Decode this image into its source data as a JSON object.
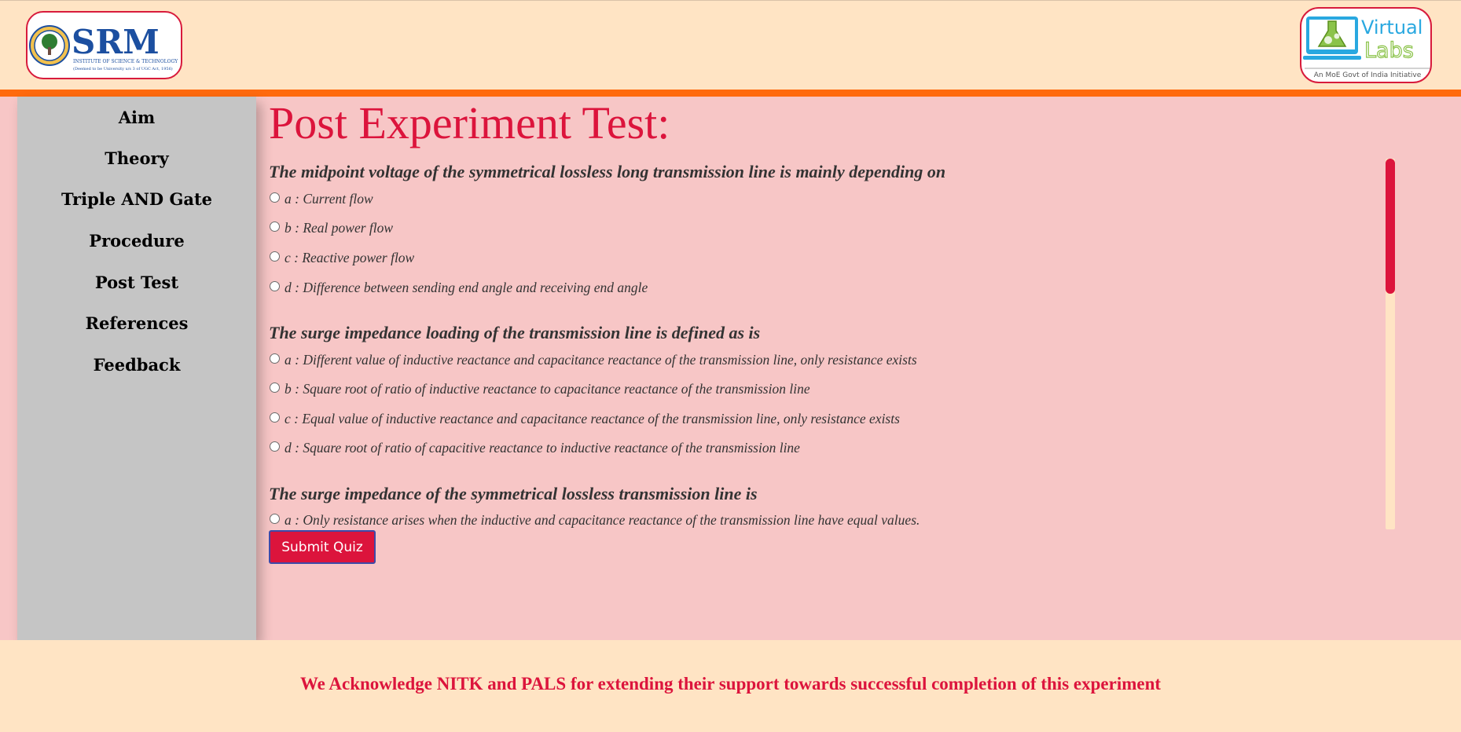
{
  "header": {
    "srm_logo": {
      "name": "SRM",
      "subtitle": "INSTITUTE OF SCIENCE & TECHNOLOGY",
      "tagline": "(Deemed to be University u/s 3 of UGC Act, 1956)"
    },
    "vlabs_logo": {
      "line1": "Virtual",
      "line2": "Labs",
      "tagline": "An MoE Govt of India Initiative"
    }
  },
  "sidebar": {
    "items": [
      {
        "label": "Aim"
      },
      {
        "label": "Theory"
      },
      {
        "label": "Triple AND Gate"
      },
      {
        "label": "Procedure"
      },
      {
        "label": "Post Test"
      },
      {
        "label": "References"
      },
      {
        "label": "Feedback"
      }
    ]
  },
  "main": {
    "title": "Post Experiment Test:",
    "questions": [
      {
        "text": "The midpoint voltage of the symmetrical lossless long transmission line is mainly depending on",
        "options": [
          "a : Current flow",
          "b : Real power flow",
          "c : Reactive power flow",
          "d : Difference between sending end angle and receiving end angle"
        ]
      },
      {
        "text": "The surge impedance loading of the transmission line is defined as is",
        "options": [
          "a : Different value of inductive reactance and capacitance reactance of the transmission line, only resistance exists",
          "b : Square root of ratio of inductive reactance to capacitance reactance of the transmission line",
          "c : Equal value of inductive reactance and capacitance reactance of the transmission line, only resistance exists",
          "d : Square root of ratio of capacitive reactance to inductive reactance of the transmission line"
        ]
      },
      {
        "text": "The surge impedance of the symmetrical lossless transmission line is",
        "options": [
          "a : Only resistance arises when the inductive and capacitance reactance of the transmission line have equal values."
        ]
      }
    ],
    "submit_label": "Submit Quiz"
  },
  "footer": {
    "acknowledgement": "We Acknowledge NITK and PALS for extending their support towards successful completion of this experiment"
  },
  "colors": {
    "accent": "#dc143c",
    "header_bg": "#ffe4c4",
    "orange_bar": "#ff6a0e",
    "page_bg": "#f7c6c6",
    "sidebar_bg": "#c5c5c5"
  }
}
